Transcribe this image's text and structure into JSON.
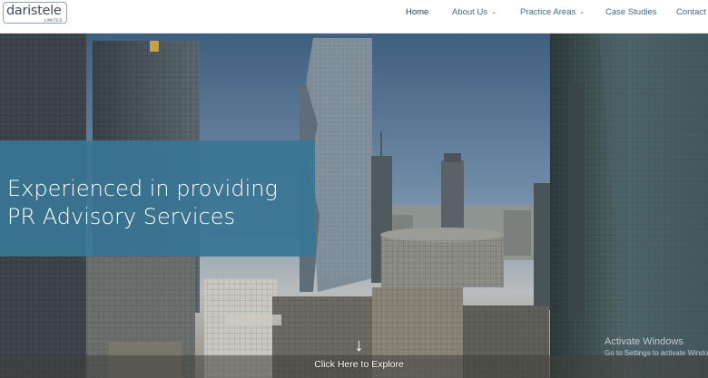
{
  "brand": {
    "name": "daristele",
    "subline": "LIMITED"
  },
  "nav": {
    "items": [
      {
        "label": "Home",
        "has_dropdown": false,
        "active": true
      },
      {
        "label": "About Us",
        "has_dropdown": true,
        "active": false
      },
      {
        "label": "Practice Areas",
        "has_dropdown": true,
        "active": false
      },
      {
        "label": "Case Studies",
        "has_dropdown": false,
        "active": false
      },
      {
        "label": "Contact",
        "has_dropdown": false,
        "active": false
      }
    ]
  },
  "hero": {
    "headline": "Experienced in providing\nPR Advisory Services",
    "explore_label": "Click Here to Explore",
    "explore_icon": "arrow-down-icon",
    "background": "city-skyline-photo"
  },
  "watermark": {
    "title": "Activate Windows",
    "subtitle": "Go to Settings to activate Windows."
  },
  "colors": {
    "overlay": "#397593",
    "nav_text": "#3f6a7d",
    "logo_text": "#3f4e58"
  }
}
